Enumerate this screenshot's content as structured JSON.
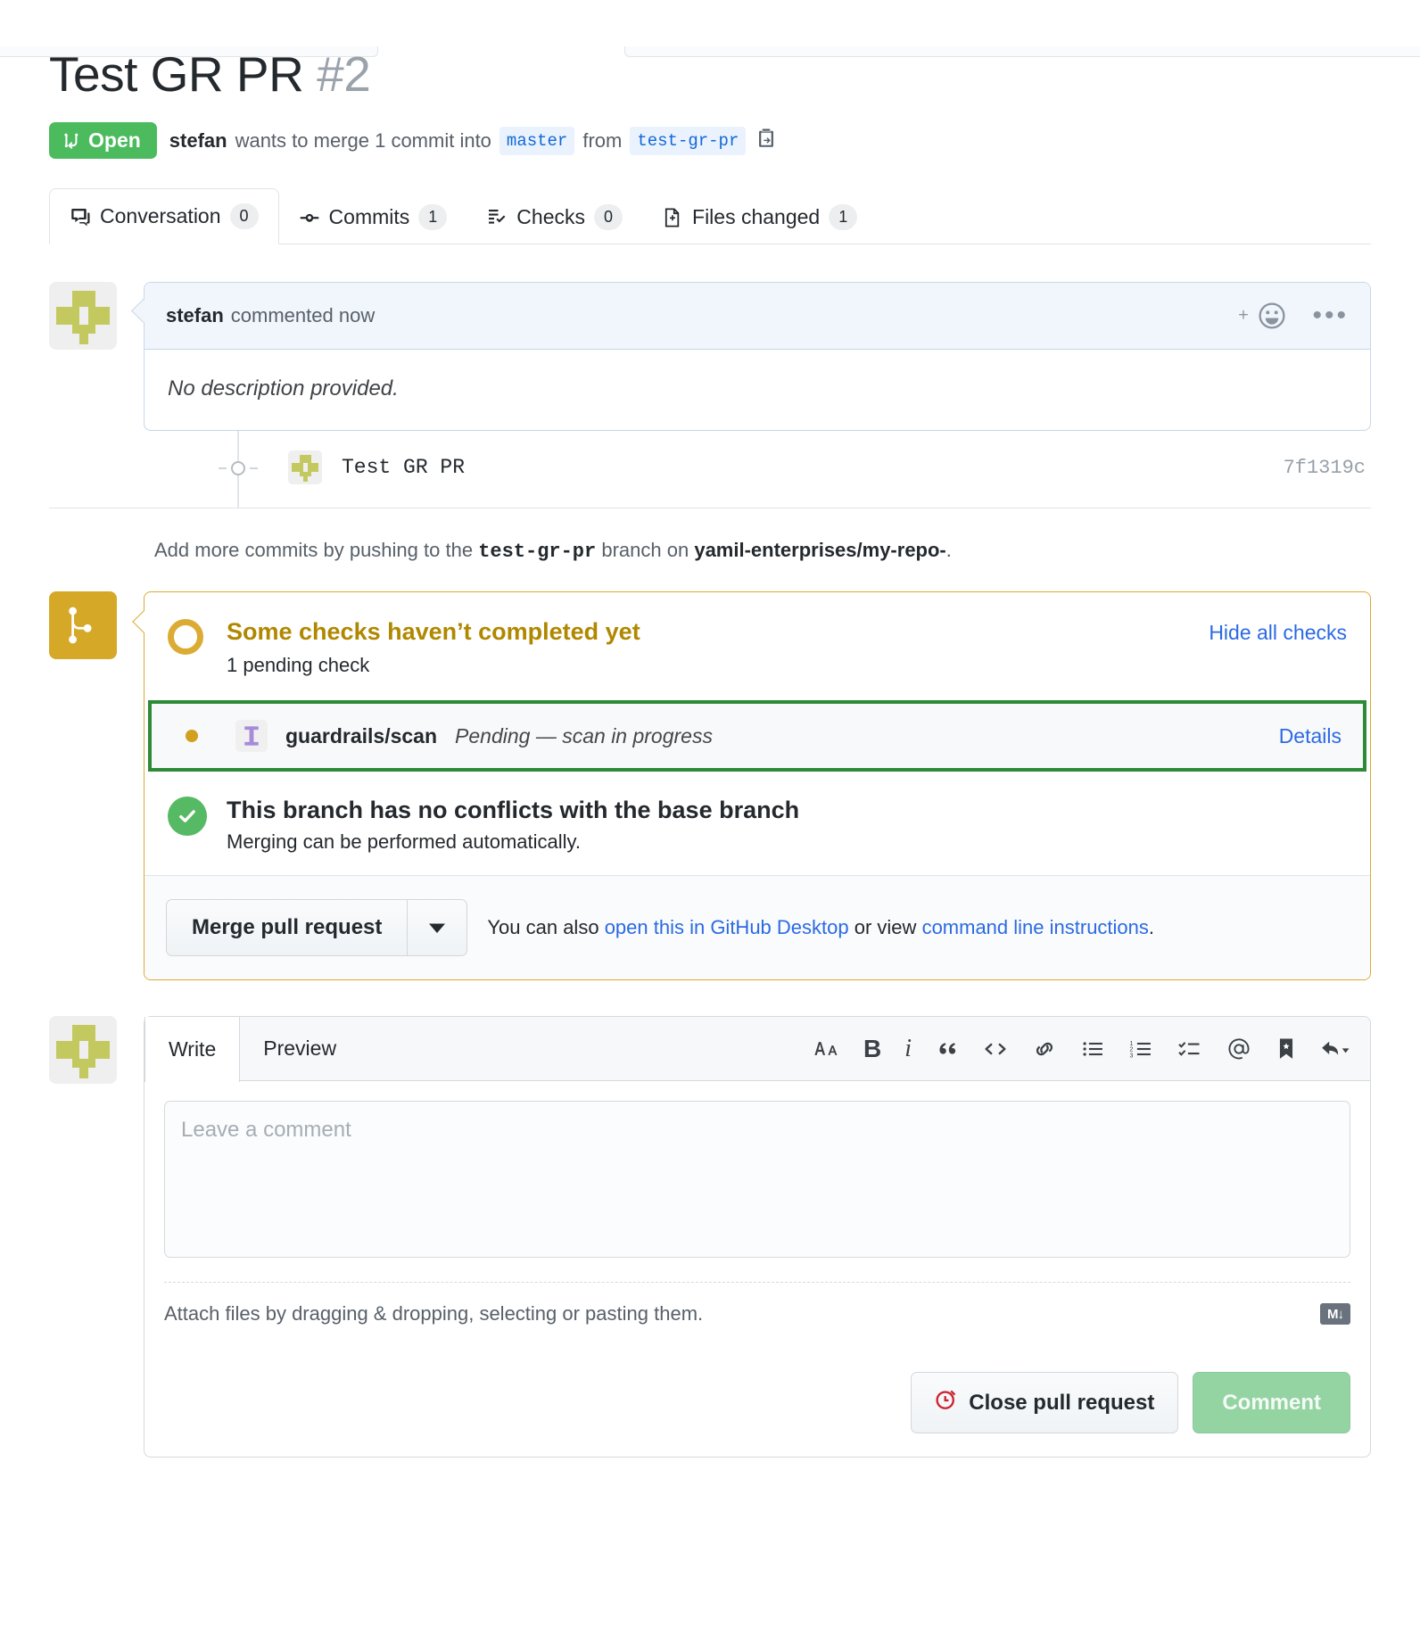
{
  "header": {
    "title": "Test GR PR",
    "number": "#2",
    "state": "Open",
    "author": "stefan",
    "merge_sentence_1": "wants to merge 1 commit into",
    "base_branch": "master",
    "merge_sentence_2": "from",
    "head_branch": "test-gr-pr"
  },
  "tabs": [
    {
      "label": "Conversation",
      "count": "0",
      "icon": "comment-icon",
      "selected": true
    },
    {
      "label": "Commits",
      "count": "1",
      "icon": "commit-icon",
      "selected": false
    },
    {
      "label": "Checks",
      "count": "0",
      "icon": "checks-icon",
      "selected": false
    },
    {
      "label": "Files changed",
      "count": "1",
      "icon": "file-diff-icon",
      "selected": false
    }
  ],
  "comment": {
    "author": "stefan",
    "action": "commented now",
    "body": "No description provided."
  },
  "commit": {
    "message": "Test GR PR",
    "sha": "7f1319c"
  },
  "push_note": {
    "prefix": "Add more commits by pushing to the",
    "branch": "test-gr-pr",
    "middle": "branch on",
    "repo": "yamil-enterprises/my-repo-",
    "suffix": "."
  },
  "merge_box": {
    "status_title": "Some checks haven’t completed yet",
    "status_sub": "1 pending check",
    "hide_checks_label": "Hide all checks",
    "check": {
      "name": "guardrails/scan",
      "description": "Pending — scan in progress",
      "details_label": "Details",
      "app_icon": "guardrails-icon"
    },
    "conflict_title": "This branch has no conflicts with the base branch",
    "conflict_sub": "Merging can be performed automatically.",
    "merge_button": "Merge pull request",
    "note_prefix": "You can also",
    "note_link1": "open this in GitHub Desktop",
    "note_middle": "or view",
    "note_link2": "command line instructions",
    "note_suffix": "."
  },
  "comment_form": {
    "tab_write": "Write",
    "tab_preview": "Preview",
    "placeholder": "Leave a comment",
    "attach_text": "Attach files by dragging & dropping, selecting or pasting them.",
    "markdown_badge": "M↓",
    "close_button": "Close pull request",
    "comment_button": "Comment",
    "toolbar": [
      {
        "name": "heading-icon",
        "glyph": "AA"
      },
      {
        "name": "bold-icon",
        "glyph": "B"
      },
      {
        "name": "italic-icon",
        "glyph": "i"
      },
      {
        "name": "quote-icon",
        "glyph": "“"
      },
      {
        "name": "code-icon",
        "glyph": "<>"
      },
      {
        "name": "link-icon",
        "glyph": "⚭"
      },
      {
        "name": "unordered-list-icon",
        "glyph": "☰"
      },
      {
        "name": "ordered-list-icon",
        "glyph": "☰"
      },
      {
        "name": "task-list-icon",
        "glyph": "✓"
      },
      {
        "name": "mention-icon",
        "glyph": "@"
      },
      {
        "name": "reference-icon",
        "glyph": "⚑"
      },
      {
        "name": "reply-icon",
        "glyph": "↩"
      }
    ]
  },
  "colors": {
    "open_green": "#4bbb5e",
    "pending_yellow": "#dbab34",
    "link_blue": "#2b6ae3",
    "highlight_green": "#2d8a36",
    "success_green": "#56b964",
    "avatar_olive": "#c4c95f",
    "guardrails_purple": "#a78bd8"
  }
}
